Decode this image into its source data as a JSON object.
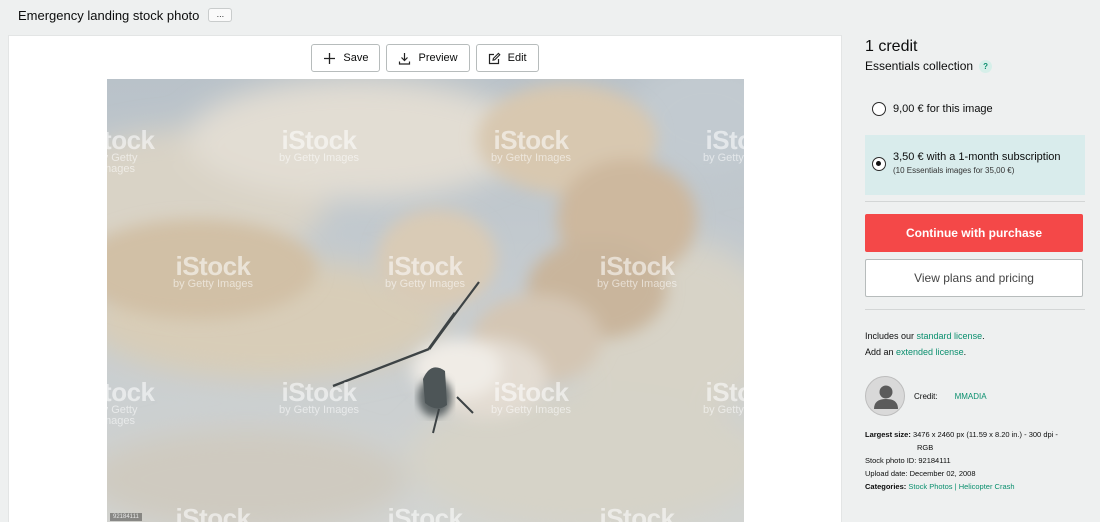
{
  "header": {
    "title": "Emergency landing stock photo",
    "more_label": "..."
  },
  "toolbar": {
    "save_label": "Save",
    "preview_label": "Preview",
    "edit_label": "Edit"
  },
  "image": {
    "watermark_brand": "iStock",
    "watermark_tag": "by Getty Images",
    "id_overlay": "92184111"
  },
  "pricing": {
    "credits": "1 credit",
    "collection": "Essentials collection",
    "help_glyph": "?",
    "option_single": "9,00 € for this image",
    "option_subscription": "3,50 € with a 1-month subscription",
    "option_subscription_note": "(10 Essentials images for 35,00 €)",
    "selected_option": "subscription",
    "purchase_label": "Continue with purchase",
    "plans_label": "View plans and pricing"
  },
  "license": {
    "includes_prefix": "Includes our ",
    "standard_link": "standard license",
    "includes_suffix": ".",
    "add_prefix": "Add an ",
    "extended_link": "extended license",
    "add_suffix": "."
  },
  "contributor": {
    "label": "Credit:",
    "name": "MMADIA"
  },
  "details": {
    "size_label": "Largest size:",
    "size_value": "3476 x 2460 px (11.59 x 8.20 in.) - 300 dpi -",
    "size_value_2": "RGB",
    "id_label": "Stock photo ID:",
    "id_value": "92184111",
    "date_label": "Upload date:",
    "date_value": "December 02, 2008",
    "cat_label": "Categories:",
    "cat_1": "Stock Photos",
    "cat_sep": " | ",
    "cat_2": "Helicopter Crash"
  },
  "colors": {
    "accent_green": "#0a8f6e",
    "purchase_red": "#f44848",
    "selected_option_bg": "#d9ecec"
  },
  "icons": [
    "plus-icon",
    "download-icon",
    "edit-icon",
    "help-icon",
    "avatar-icon"
  ]
}
